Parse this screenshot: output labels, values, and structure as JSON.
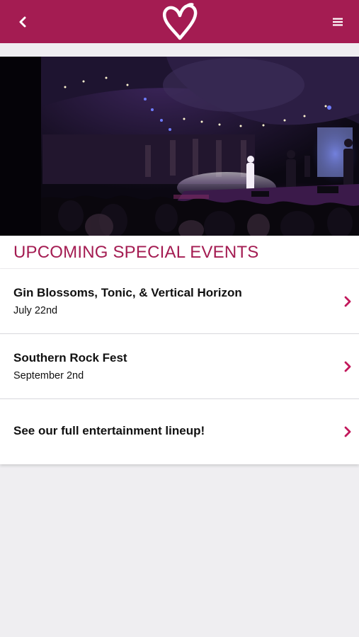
{
  "header": {
    "back_icon": "chevron-left-icon",
    "logo_icon": "heart-logo-icon",
    "menu_icon": "hamburger-menu-icon",
    "bar_color": "#a41c52"
  },
  "hero": {
    "image": "concert-stage-photo"
  },
  "section": {
    "title": "UPCOMING SPECIAL EVENTS",
    "accent_color": "#a41c52"
  },
  "events": [
    {
      "name": "Gin Blossoms, Tonic, & Vertical Horizon",
      "date": "July 22nd"
    },
    {
      "name": "Southern Rock Fest",
      "date": "September 2nd"
    },
    {
      "name": "See our full entertainment lineup!",
      "date": ""
    }
  ],
  "chevron_color": "#c2185b"
}
